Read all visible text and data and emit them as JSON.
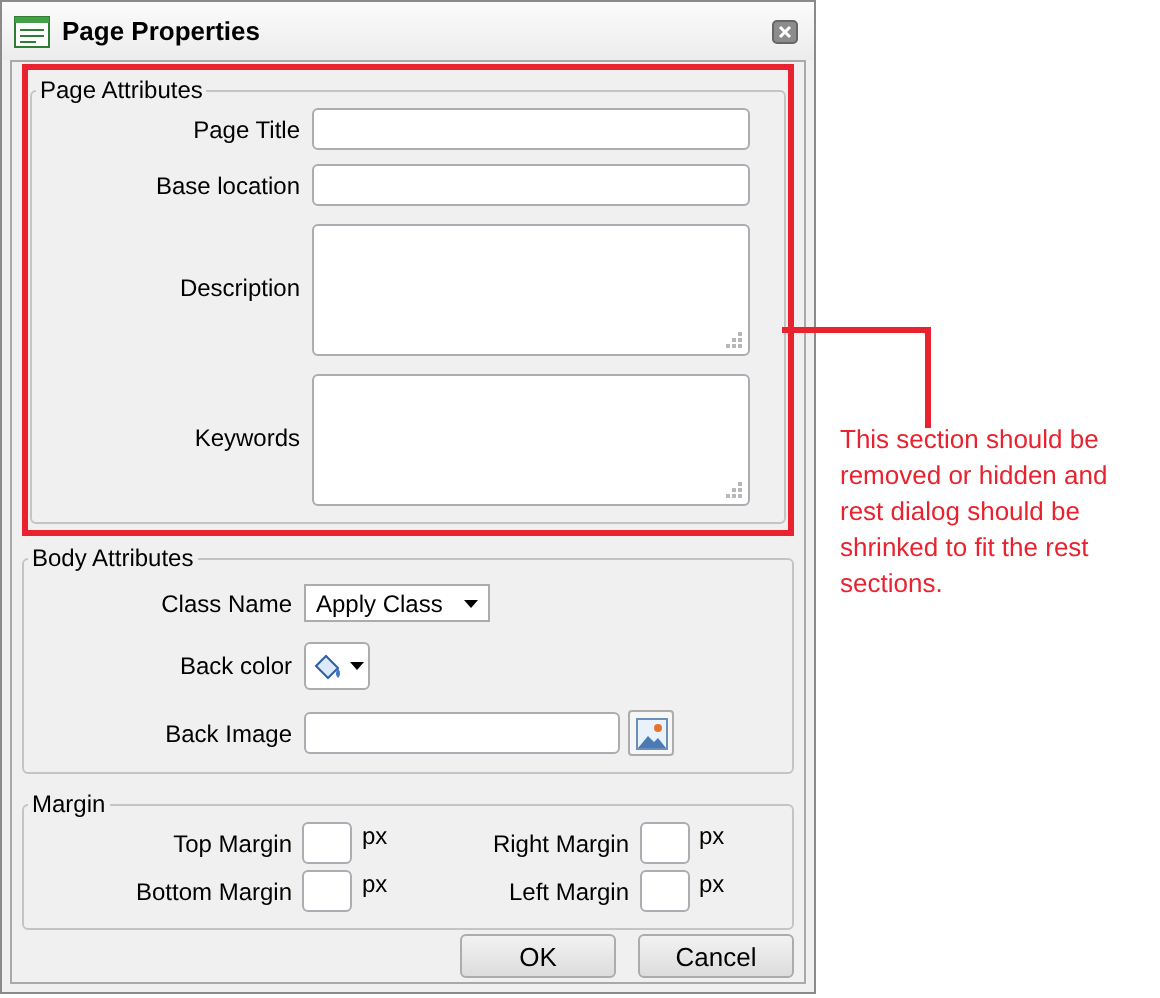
{
  "window": {
    "title": "Page Properties"
  },
  "page_attributes": {
    "legend": "Page Attributes",
    "fields": [
      {
        "kind": "input",
        "label": "Page Title"
      },
      {
        "kind": "input",
        "label": "Base location"
      },
      {
        "kind": "textarea",
        "label": "Description"
      },
      {
        "kind": "textarea",
        "label": "Keywords"
      }
    ]
  },
  "body_attributes": {
    "legend": "Body Attributes",
    "fields": [
      {
        "kind": "select",
        "label": "Class Name",
        "value": "Apply Class"
      },
      {
        "kind": "color",
        "label": "Back color"
      },
      {
        "kind": "image",
        "label": "Back Image"
      }
    ]
  },
  "margin": {
    "legend": "Margin",
    "fields": [
      {
        "label": "Top Margin",
        "unit": "px"
      },
      {
        "label": "Right Margin",
        "unit": "px"
      },
      {
        "label": "Bottom Margin",
        "unit": "px"
      },
      {
        "label": "Left Margin",
        "unit": "px"
      }
    ]
  },
  "buttons": [
    "OK",
    "Cancel"
  ],
  "annotation": {
    "text": "This section should be removed or hidden and rest dialog should be shrinked to fit the rest sections."
  }
}
